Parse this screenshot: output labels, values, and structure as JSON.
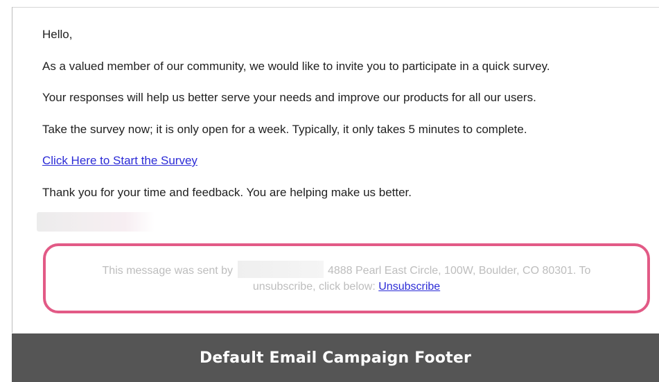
{
  "email": {
    "greeting": "Hello,",
    "paragraph_1": "As a valued member of our community, we would like to invite you to participate in a quick survey.",
    "paragraph_2": "Your responses will help us better serve your needs and improve our products for all our users.",
    "paragraph_3": "Take the survey now; it is only open for a week. Typically, it only takes 5 minutes to complete.",
    "survey_link": "Click Here to Start the Survey",
    "closing": "Thank you for your time and feedback. You are helping make us better."
  },
  "footer": {
    "sent_by_prefix": "This message was sent by",
    "address": "4888 Pearl East Circle, 100W, Boulder, CO 80301. To",
    "unsubscribe_prefix": "unsubscribe, click below:",
    "unsubscribe_link": "Unsubscribe"
  },
  "caption": "Default Email Campaign Footer",
  "colors": {
    "highlight": "#e25a86",
    "link": "#2b2bd6",
    "caption_bg": "#555555"
  }
}
